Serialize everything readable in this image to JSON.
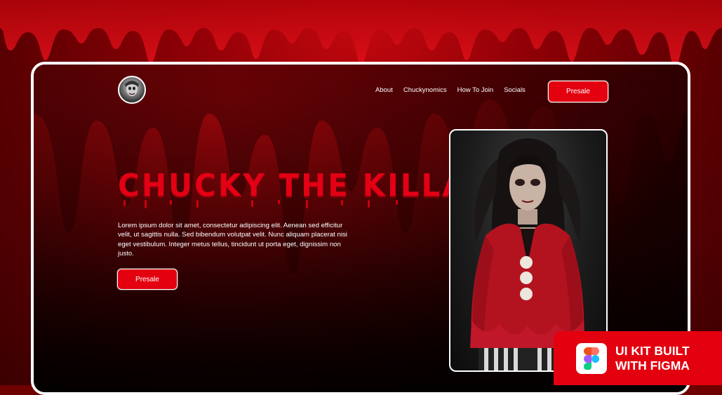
{
  "brand": {
    "logo_icon": "skull-avatar-icon",
    "accent_color": "#e3000f",
    "background_color": "#8d0006"
  },
  "nav": {
    "links": [
      "About",
      "Chuckynomics",
      "How To Join",
      "Socials"
    ],
    "presale_label": "Presale"
  },
  "hero": {
    "title": "CHUCKY THE KILLAR",
    "description": "Lorem ipsum dolor sit amet, consectetur adipiscing elit. Aenean sed efficitur velit, ut sagittis nulla. Sed bibendum volutpat velit. Nunc aliquam placerat nisi eget vestibulum. Integer metus tellus, tincidunt ut porta eget, dignissim non justo.",
    "cta_label": "Presale",
    "portrait_icon": "clown-girl-portrait"
  },
  "badge": {
    "line1": "UI KIT BUILT",
    "line2": "WITH FIGMA",
    "icon": "figma-logo-icon"
  }
}
